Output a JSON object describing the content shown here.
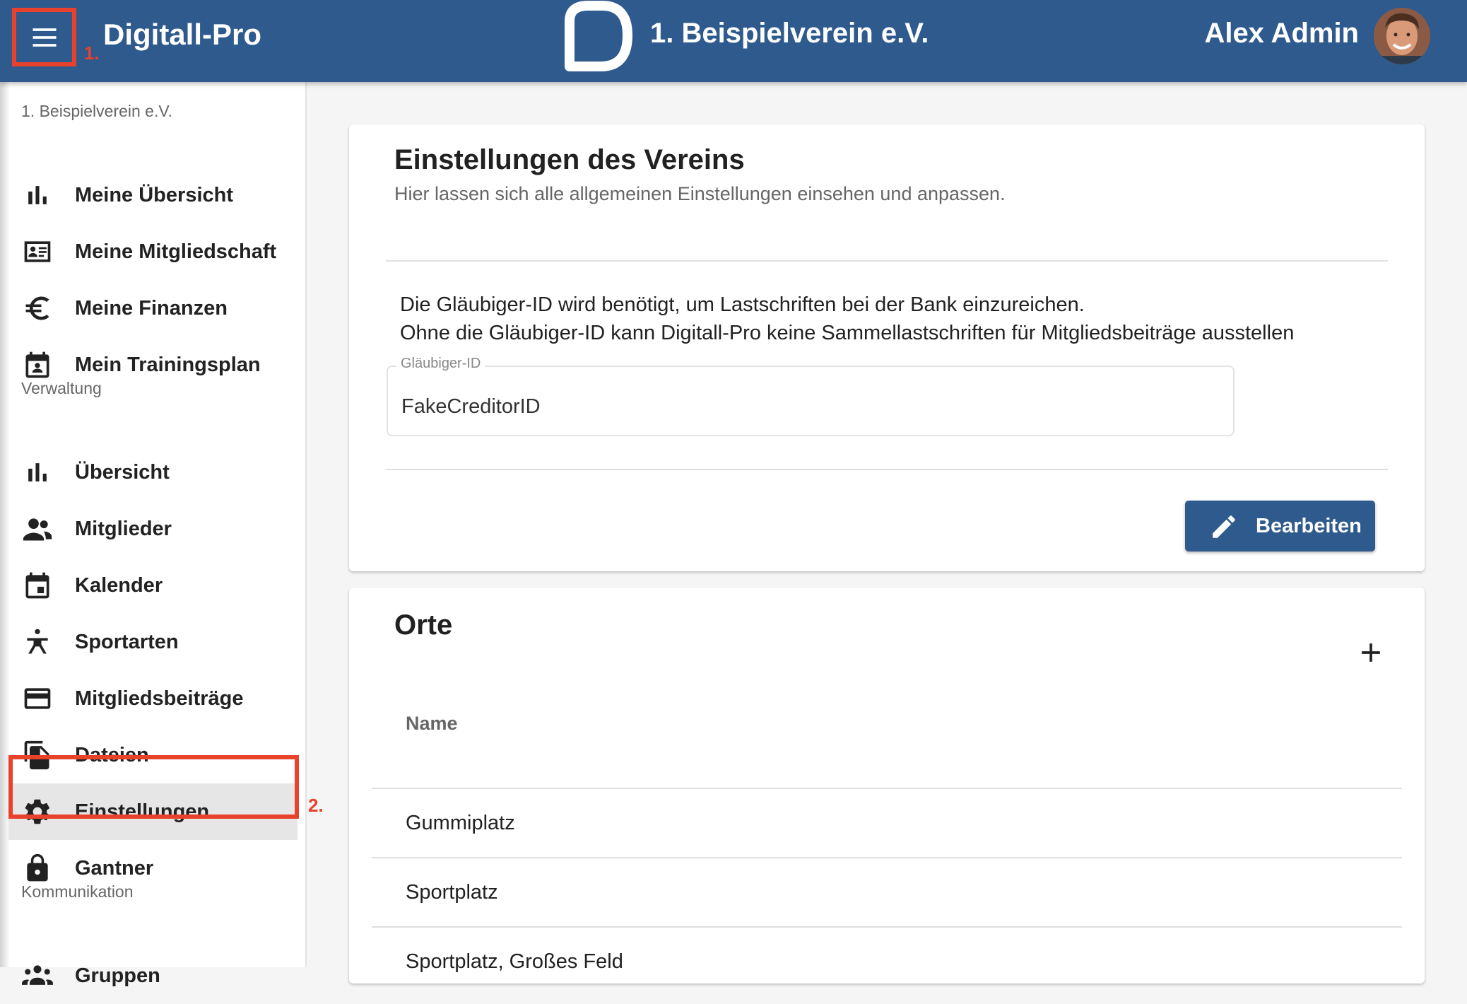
{
  "header": {
    "app_title": "Digitall-Pro",
    "org_title": "1. Beispielverein e.V.",
    "user_name": "Alex Admin",
    "brand_color": "#2e5a8e"
  },
  "annotations": {
    "step1": "1.",
    "step2": "2.",
    "color": "#e8412c"
  },
  "sidebar": {
    "org_label": "1. Beispielverein e.V.",
    "personal": [
      {
        "label": "Meine Übersicht",
        "icon": "bar-chart-icon"
      },
      {
        "label": "Meine Mitgliedschaft",
        "icon": "id-card-icon"
      },
      {
        "label": "Meine Finanzen",
        "icon": "euro-icon"
      },
      {
        "label": "Mein Trainingsplan",
        "icon": "calendar-person-icon"
      }
    ],
    "admin_label": "Verwaltung",
    "admin": [
      {
        "label": "Übersicht",
        "icon": "bar-chart-icon"
      },
      {
        "label": "Mitglieder",
        "icon": "people-icon"
      },
      {
        "label": "Kalender",
        "icon": "calendar-icon"
      },
      {
        "label": "Sportarten",
        "icon": "sport-figure-icon"
      },
      {
        "label": "Mitgliedsbeiträge",
        "icon": "credit-card-icon"
      },
      {
        "label": "Dateien",
        "icon": "files-icon"
      },
      {
        "label": "Einstellungen",
        "icon": "gear-icon"
      },
      {
        "label": "Gantner",
        "icon": "lock-icon"
      }
    ],
    "comm_label": "Kommunikation",
    "comm": [
      {
        "label": "Gruppen",
        "icon": "groups-icon"
      }
    ]
  },
  "settings": {
    "title": "Einstellungen des Vereins",
    "subtitle": "Hier lassen sich alle allgemeinen Einstellungen einsehen und anpassen.",
    "info_line1": "Die Gläubiger-ID wird benötigt, um Lastschriften bei der Bank einzureichen.",
    "info_line2": "Ohne die Gläubiger-ID kann Digitall-Pro keine Sammellastschriften für Mitgliedsbeiträge ausstellen",
    "creditor_label": "Gläubiger-ID",
    "creditor_value": "FakeCreditorID",
    "edit_label": "Bearbeiten"
  },
  "places": {
    "title": "Orte",
    "column_name": "Name",
    "rows": [
      "Gummiplatz",
      "Sportplatz",
      "Sportplatz, Großes Feld"
    ]
  }
}
